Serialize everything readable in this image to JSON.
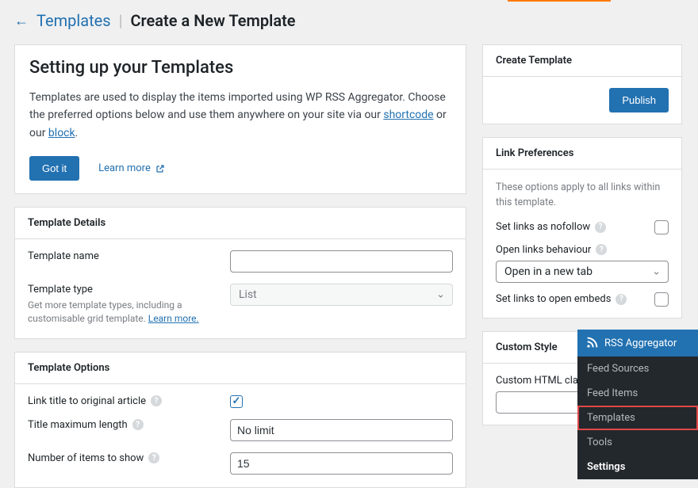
{
  "breadcrumb": {
    "link": "Templates",
    "title": "Create a New Template"
  },
  "setup": {
    "title": "Setting up your Templates",
    "text_before": "Templates are used to display the items imported using WP RSS Aggregator. Choose the preferred options below and use them anywhere on your site via our ",
    "link1": "shortcode",
    "text_mid": " or our ",
    "link2": "block",
    "text_after": ".",
    "got_it": "Got it",
    "learn_more": "Learn more"
  },
  "details": {
    "panel_title": "Template Details",
    "name_label": "Template name",
    "name_value": "",
    "type_label": "Template type",
    "type_value": "List",
    "type_hint_before": "Get more template types, including a customisable grid template. ",
    "type_hint_link": "Learn more."
  },
  "options": {
    "panel_title": "Template Options",
    "link_title_label": "Link title to original article",
    "title_max_label": "Title maximum length",
    "title_max_value": "No limit",
    "num_items_label": "Number of items to show",
    "num_items_value": "15"
  },
  "create": {
    "panel_title": "Create Template",
    "publish": "Publish"
  },
  "linkprefs": {
    "panel_title": "Link Preferences",
    "note": "These options apply to all links within this template.",
    "nofollow_label": "Set links as nofollow",
    "behaviour_label": "Open links behaviour",
    "behaviour_value": "Open in a new tab",
    "embeds_label": "Set links to open embeds"
  },
  "custom_style": {
    "panel_title": "Custom Style",
    "html_class_label": "Custom HTML class",
    "html_class_value": ""
  },
  "admin_menu": {
    "head": "RSS Aggregator",
    "items": [
      "Feed Sources",
      "Feed Items",
      "Templates",
      "Tools",
      "Settings"
    ]
  }
}
